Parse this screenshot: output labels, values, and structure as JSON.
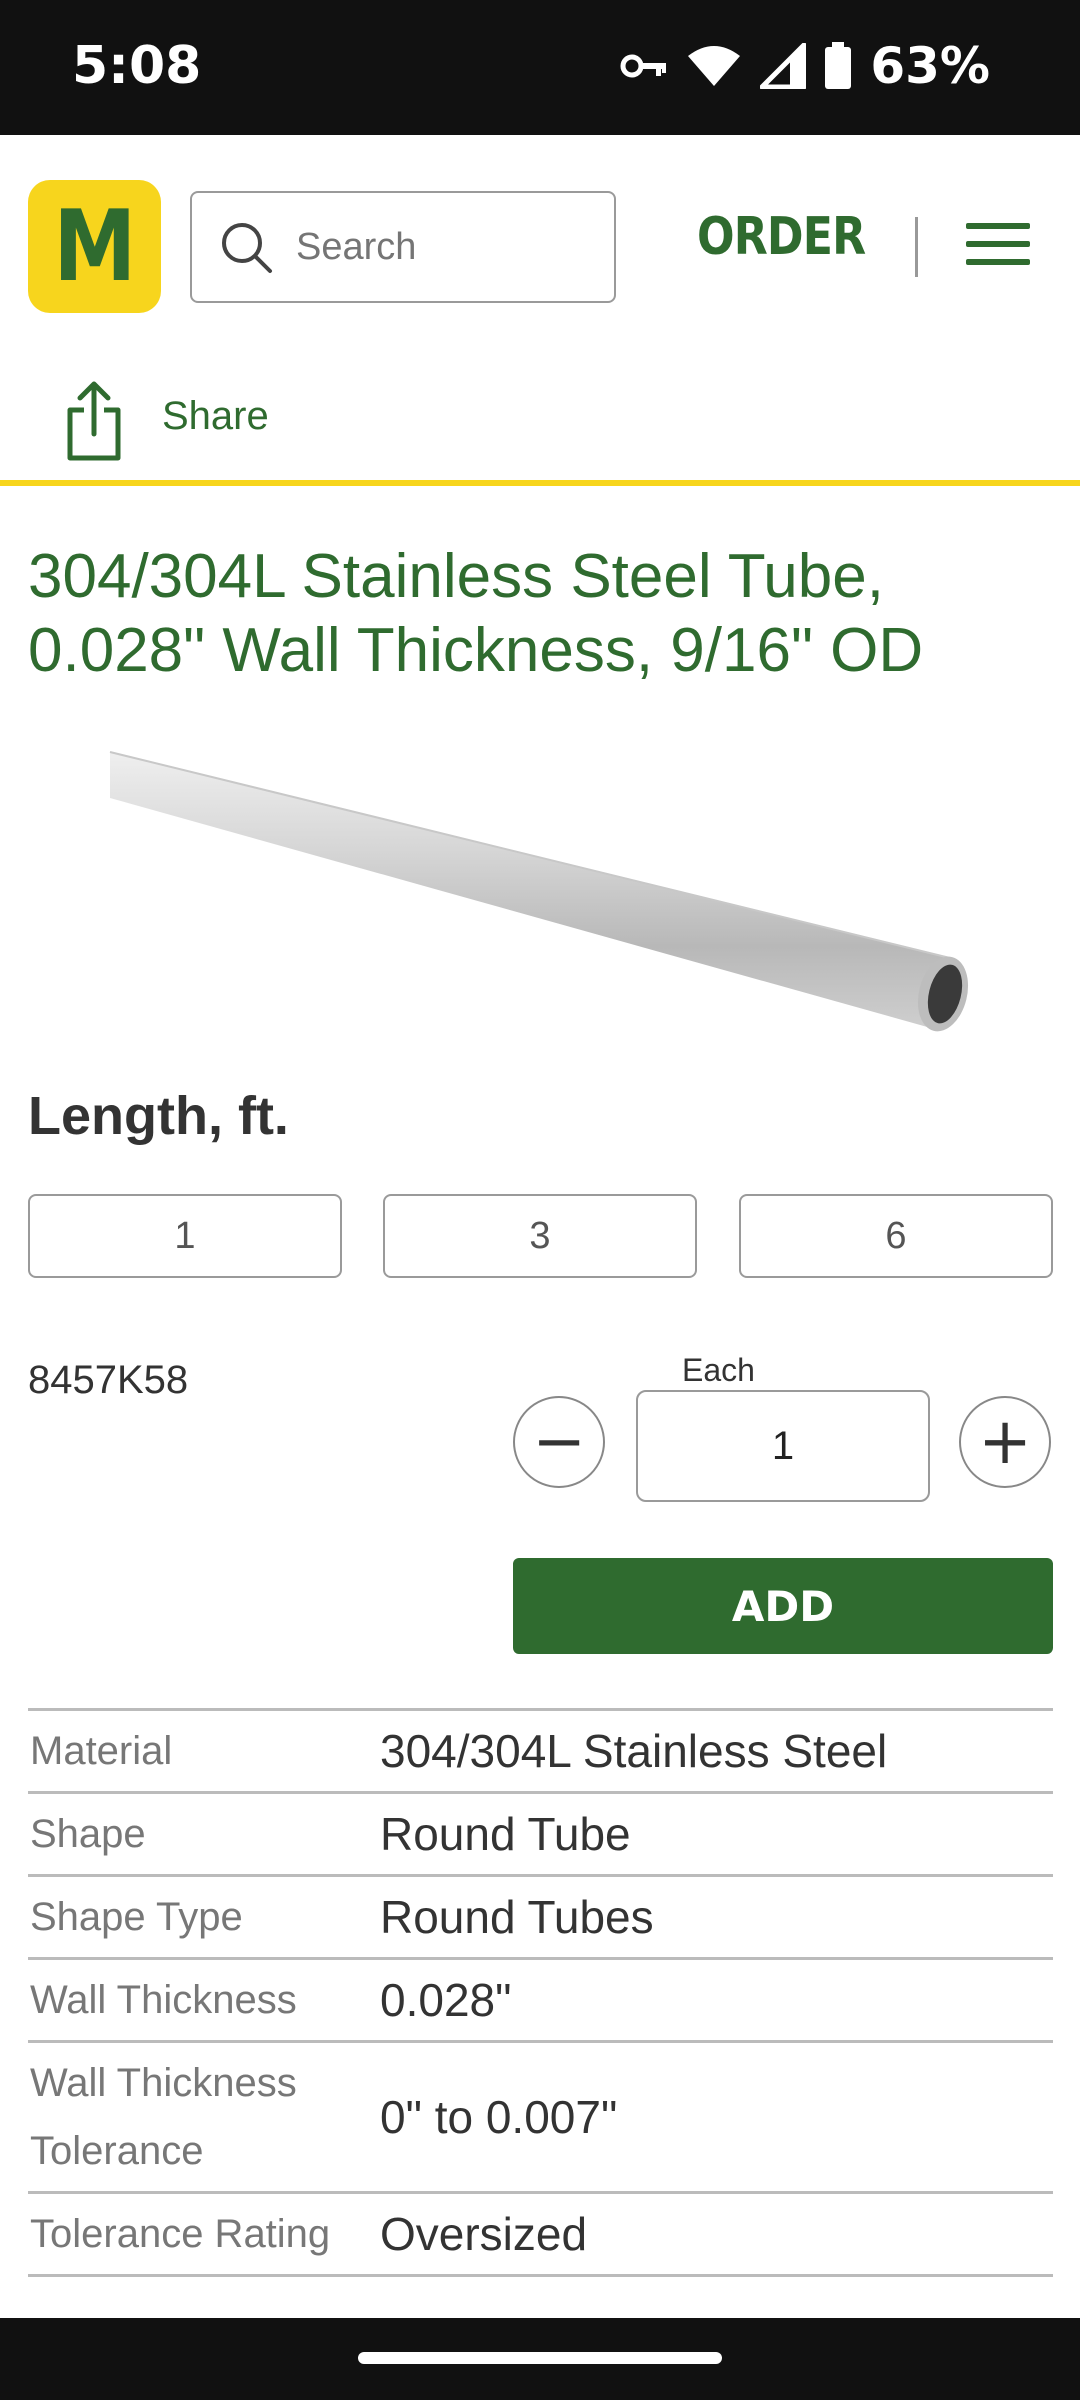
{
  "status_bar": {
    "time": "5:08",
    "battery": "63%"
  },
  "header": {
    "logo_letter": "M",
    "search_placeholder": "Search",
    "order_label": "ORDER"
  },
  "share": {
    "label": "Share"
  },
  "product": {
    "title": "304/304L Stainless Steel Tube, 0.028\" Wall Thickness, 9/16\" OD",
    "length_label": "Length, ft.",
    "length_options": [
      "1",
      "3",
      "6"
    ],
    "part_number": "8457K58",
    "quantity_unit": "Each",
    "quantity": "1",
    "add_label": "ADD"
  },
  "specs": [
    {
      "key": "Material",
      "value": "304/304L Stainless Steel"
    },
    {
      "key": "Shape",
      "value": "Round Tube"
    },
    {
      "key": "Shape Type",
      "value": "Round Tubes"
    },
    {
      "key": "Wall Thickness",
      "value": "0.028\""
    },
    {
      "key": "Wall Thickness Tolerance",
      "value": "0\" to 0.007\""
    },
    {
      "key": "Tolerance Rating",
      "value": "Oversized"
    }
  ],
  "colors": {
    "brand_green": "#2f6b2f",
    "brand_yellow": "#f7d51d"
  }
}
